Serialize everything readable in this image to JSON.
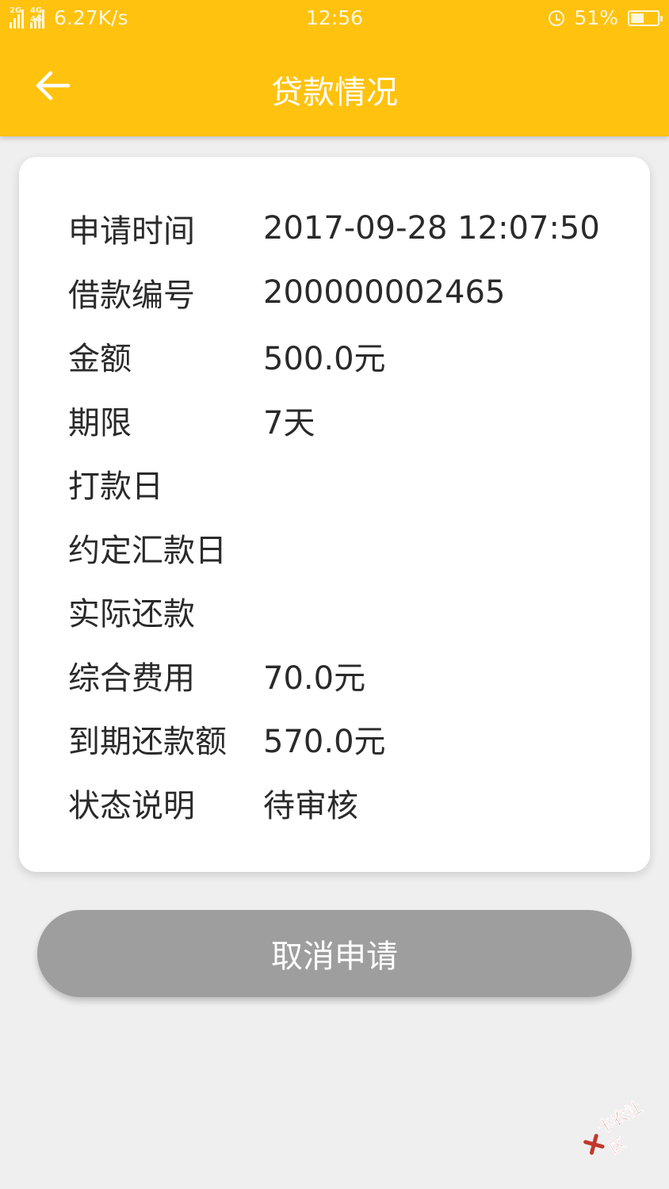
{
  "status_bar": {
    "signal1": "2G",
    "signal2": "4G 4G",
    "speed": "6.27K/s",
    "time": "12:56",
    "battery": "51%",
    "battery_level": 0.51
  },
  "header": {
    "title": "贷款情况"
  },
  "details": [
    {
      "label": "申请时间",
      "value": "2017-09-28 12:07:50"
    },
    {
      "label": "借款编号",
      "value": "200000002465"
    },
    {
      "label": "金额",
      "value": "500.0元"
    },
    {
      "label": "期限",
      "value": "7天"
    },
    {
      "label": "打款日",
      "value": ""
    },
    {
      "label": "约定汇款日",
      "value": ""
    },
    {
      "label": "实际还款",
      "value": ""
    },
    {
      "label": "综合费用",
      "value": "70.0元"
    },
    {
      "label": "到期还款额",
      "value": "570.0元"
    },
    {
      "label": "状态说明",
      "value": "待审核"
    }
  ],
  "actions": {
    "cancel_label": "取消申请"
  },
  "watermark": {
    "text": "卡农社区"
  },
  "colors": {
    "primary": "#ffc20e",
    "button_disabled": "#9e9e9e",
    "watermark": "#c0392b"
  }
}
